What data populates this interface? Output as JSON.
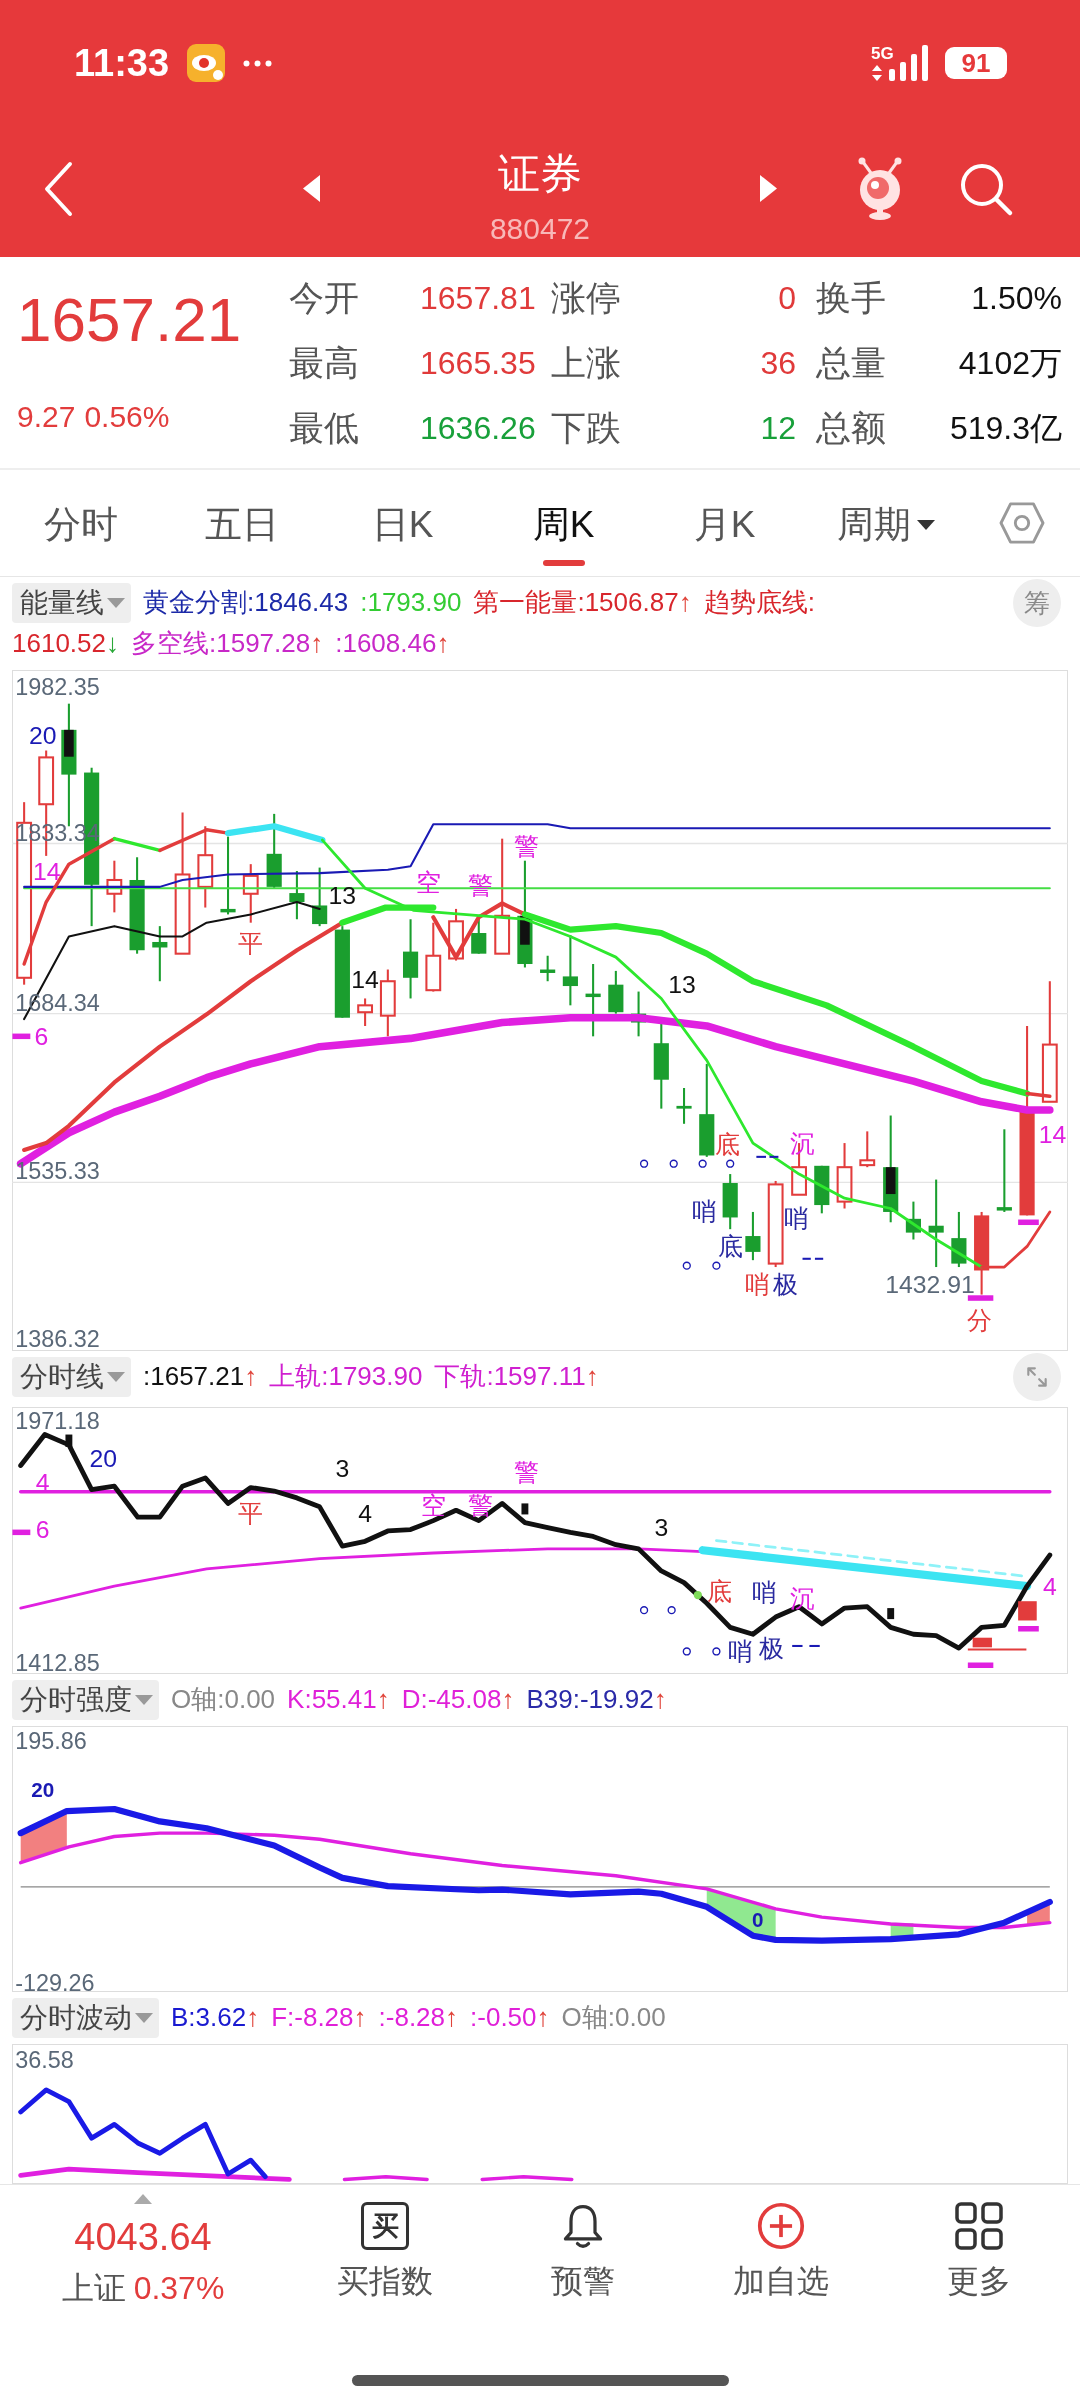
{
  "status_bar": {
    "time": "11:33",
    "network": "5G",
    "battery": "91"
  },
  "title_bar": {
    "title": "证券",
    "code": "880472"
  },
  "quote": {
    "price": "1657.21",
    "change": "9.27",
    "change_percent": "0.56%",
    "rows": [
      {
        "label": "今开",
        "value": "1657.81",
        "label_2": "涨停",
        "count": "0",
        "label_3": "换手",
        "value_3": "1.50%",
        "color": "#e03a3a"
      },
      {
        "label": "最高",
        "value": "1665.35",
        "label_2": "上涨",
        "count": "36",
        "label_3": "总量",
        "value_3": "4102万",
        "color": "#e03a3a"
      },
      {
        "label": "最低",
        "value": "1636.26",
        "label_2": "下跌",
        "count": "12",
        "label_3": "总额",
        "value_3": "519.3亿",
        "color": "#18a03a"
      }
    ]
  },
  "tabs": [
    {
      "label": "分时",
      "selected": false,
      "kind": "tab"
    },
    {
      "label": "五日",
      "selected": false,
      "kind": "tab"
    },
    {
      "label": "日K",
      "selected": false,
      "kind": "tab"
    },
    {
      "label": "周K",
      "selected": true,
      "kind": "tab"
    },
    {
      "label": "月K",
      "selected": false,
      "kind": "tab"
    },
    {
      "label": "周期",
      "selected": false,
      "kind": "dropdown"
    }
  ],
  "panels": [
    {
      "kind": "energy",
      "selector": "能量线",
      "action": {
        "kind": "text",
        "label": "筹"
      },
      "readouts": [
        {
          "text": "黄金分割:1846.43",
          "color": "#1c2aa8"
        },
        {
          "text": ":1793.90",
          "color": "#33cc33"
        },
        {
          "text": "第一能量:1506.87",
          "color": "#d8262c",
          "arrow": {
            "text": "↑",
            "color": "#e0443a"
          }
        },
        {
          "text": "趋势底线:",
          "color": "#d8262c"
        },
        {
          "text": "1610.52",
          "color": "#d8262c",
          "arrow": {
            "text": "↓",
            "color": "#2aa838"
          }
        },
        {
          "text": "多空线:1597.28",
          "color": "#c828c8",
          "arrow": {
            "text": "↑",
            "color": "#e0443a"
          }
        },
        {
          "text": ":1608.46",
          "color": "#c828c8",
          "arrow": {
            "text": "↑",
            "color": "#e0443a"
          }
        }
      ],
      "axis_labels": [
        "1982.35",
        "1833.34",
        "1684.34",
        "1535.33",
        "1386.32"
      ],
      "markers": [
        {
          "text": "20",
          "color": "#1a1ab4"
        },
        {
          "text": "14",
          "color": "#e020e0"
        },
        {
          "text": "6",
          "color": "#e020e0"
        },
        {
          "text": "平",
          "color": "#e23c3c"
        },
        {
          "text": "13",
          "color": "#111111"
        },
        {
          "text": "14",
          "color": "#111111"
        },
        {
          "text": "空",
          "color": "#e020e0"
        },
        {
          "text": "警",
          "color": "#e020e0"
        },
        {
          "text": "警",
          "color": "#e020e0"
        },
        {
          "text": "13",
          "color": "#111111"
        },
        {
          "text": "底",
          "color": "#e23c3c"
        },
        {
          "text": "沉",
          "color": "#e020e0"
        },
        {
          "text": "哨",
          "color": "#2a2aa0"
        },
        {
          "text": "哨",
          "color": "#2a2aa0"
        },
        {
          "text": "底",
          "color": "#2a2aa0"
        },
        {
          "text": "哨",
          "color": "#e23c3c"
        },
        {
          "text": "极",
          "color": "#2a2aa0"
        },
        {
          "text": "1432.91",
          "color": "#5a6878"
        },
        {
          "text": "14",
          "color": "#e020e0"
        },
        {
          "text": "分",
          "color": "#e23c3c"
        }
      ]
    },
    {
      "kind": "line",
      "selector": "分时线",
      "action": {
        "kind": "expand"
      },
      "readouts": [
        {
          "text": ":1657.21",
          "color": "#111111",
          "arrow": {
            "text": "↑",
            "color": "#e0443a"
          }
        },
        {
          "text": "上轨:1793.90",
          "color": "#d020d0"
        },
        {
          "text": "下轨:1597.11",
          "color": "#d020d0",
          "arrow": {
            "text": "↑",
            "color": "#e0443a"
          }
        }
      ],
      "axis_labels": [
        "1971.18",
        "1412.85"
      ],
      "markers": [
        {
          "text": "20",
          "color": "#1a1ab4"
        },
        {
          "text": "4",
          "color": "#e020e0"
        },
        {
          "text": "6",
          "color": "#e020e0"
        },
        {
          "text": "平",
          "color": "#e23c3c"
        },
        {
          "text": "3",
          "color": "#111111"
        },
        {
          "text": "4",
          "color": "#111111"
        },
        {
          "text": "空",
          "color": "#e020e0"
        },
        {
          "text": "警",
          "color": "#e020e0"
        },
        {
          "text": "警",
          "color": "#e020e0"
        },
        {
          "text": "3",
          "color": "#111111"
        },
        {
          "text": "底",
          "color": "#e23c3c"
        },
        {
          "text": "哨",
          "color": "#2a2aa0"
        },
        {
          "text": "沉",
          "color": "#e020e0"
        },
        {
          "text": "哨",
          "color": "#2a2aa0"
        },
        {
          "text": "极",
          "color": "#2a2aa0"
        },
        {
          "text": "4",
          "color": "#e020e0"
        }
      ]
    },
    {
      "kind": "strength",
      "selector": "分时强度",
      "readouts": [
        {
          "text": "O轴:0.00",
          "color": "#888888"
        },
        {
          "text": "K:55.41",
          "color": "#e020d8",
          "arrow": {
            "text": "↑",
            "color": "#e0443a"
          }
        },
        {
          "text": "D:-45.08",
          "color": "#e020d8",
          "arrow": {
            "text": "↑",
            "color": "#e0443a"
          }
        },
        {
          "text": "B39:-19.92",
          "color": "#2a2aa8",
          "arrow": {
            "text": "↑",
            "color": "#e0443a"
          }
        }
      ],
      "axis_labels": [
        "195.86",
        "-129.26"
      ],
      "markers": [
        {
          "text": "20",
          "color": "#1a1ab4"
        },
        {
          "text": "0",
          "color": "#1a1ab4"
        }
      ]
    },
    {
      "kind": "wave",
      "selector": "分时波动",
      "readouts": [
        {
          "text": "B:3.62",
          "color": "#1a1ad0",
          "arrow": {
            "text": "↑",
            "color": "#e0443a"
          }
        },
        {
          "text": "F:-8.28",
          "color": "#e020d8",
          "arrow": {
            "text": "↑",
            "color": "#e0443a"
          }
        },
        {
          "text": ":-8.28",
          "color": "#e020d8",
          "arrow": {
            "text": "↑",
            "color": "#e0443a"
          }
        },
        {
          "text": ":-0.50",
          "color": "#e020d8",
          "arrow": {
            "text": "↑",
            "color": "#e0443a"
          }
        },
        {
          "text": "O轴:0.00",
          "color": "#888888"
        }
      ],
      "axis_labels": [
        "36.58"
      ]
    }
  ],
  "index_quote": {
    "value": "4043.64",
    "name": "上证",
    "change_percent": "0.37%"
  },
  "nav": [
    {
      "label": "买指数",
      "kind": "buy",
      "icon_text": "买"
    },
    {
      "label": "预警",
      "kind": "bell"
    },
    {
      "label": "加自选",
      "kind": "add"
    },
    {
      "label": "更多",
      "kind": "grid"
    }
  ]
}
